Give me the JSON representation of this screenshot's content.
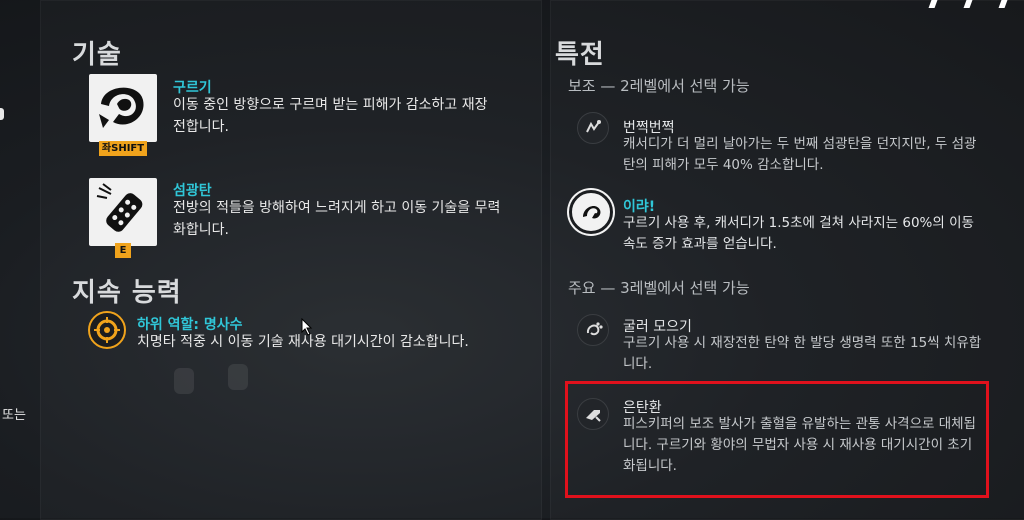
{
  "skills": {
    "title": "기술",
    "items": [
      {
        "name": "구르기",
        "desc": "이동 중인 방향으로 구르며 받는 피해가 감소하고 재장전합니다.",
        "key": "좌SHIFT",
        "icon": "roll-icon"
      },
      {
        "name": "섬광탄",
        "desc": "전방의 적들을 방해하여 느려지게 하고 이동 기술을 무력화합니다.",
        "key": "E",
        "icon": "flashbang-icon"
      }
    ]
  },
  "passive": {
    "title": "지속 능력",
    "name": "하위 역할: 명사수",
    "desc": "치명타 적중 시 이동 기술 재사용 대기시간이 감소합니다.",
    "icon": "sharpshooter-icon"
  },
  "perks": {
    "title": "특전",
    "minor_header": "보조 — 2레벨에서 선택 가능",
    "major_header": "주요 — 3레벨에서 선택 가능",
    "minor": [
      {
        "name": "번쩍번쩍",
        "desc": "캐서디가 더 멀리 날아가는 두 번째 섬광탄을 던지지만, 두 섬광탄의 피해가 모두 40% 감소합니다.",
        "selected": false
      },
      {
        "name": "이랴!",
        "desc": "구르기 사용 후, 캐서디가 1.5초에 걸쳐 사라지는 60%의 이동 속도 증가 효과를 얻습니다.",
        "selected": true
      }
    ],
    "major": [
      {
        "name": "굴러 모으기",
        "desc": "구르기 사용 시 재장전한 탄약 한 발당 생명력 또한 15씩 치유합니다.",
        "selected": false
      },
      {
        "name": "은탄환",
        "desc": "피스키퍼의 보조 발사가 출혈을 유발하는 관통 사격으로 대체됩니다. 구르기와 황야의 무법자 사용 시 재사용 대기시간이 초기화됩니다.",
        "selected": false,
        "highlighted": true
      }
    ]
  },
  "edge_text": "또는",
  "colors": {
    "accent": "#30c6d7",
    "key_badge": "#f0a31c",
    "highlight_box": "#e0111c"
  }
}
